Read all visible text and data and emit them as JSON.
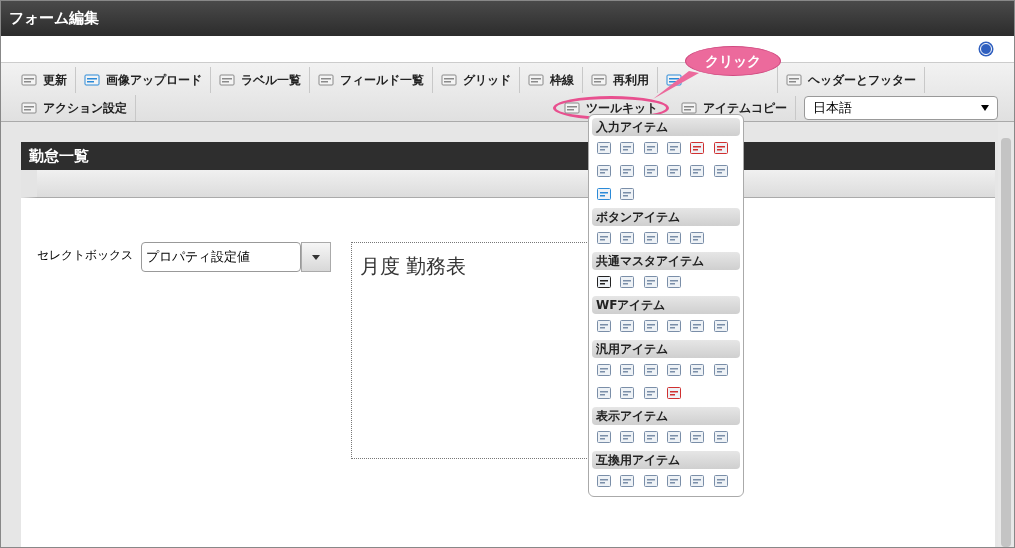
{
  "window": {
    "title": "フォーム編集"
  },
  "toolbar": {
    "row_1": [
      {
        "label": "更新"
      },
      {
        "label": "画像アップロード"
      },
      {
        "label": "ラベル一覧"
      },
      {
        "label": "フィールド一覧"
      },
      {
        "label": "グリッド"
      },
      {
        "label": "枠線"
      },
      {
        "label": "再利用"
      },
      {
        "covered": true
      },
      {
        "label": "ヘッダーとフッター"
      }
    ],
    "row_2_left": [
      {
        "label": "アクション設定"
      }
    ],
    "row_2_right": [
      {
        "label": "ツールキット",
        "highlighted": true
      },
      {
        "label": "アイテムコピー",
        "highlighted": false
      }
    ],
    "language": {
      "value": "日本語"
    }
  },
  "callout": {
    "text": "クリック"
  },
  "form": {
    "title": "勤怠一覧",
    "select_label": "セレクトボックス",
    "select_value": "プロパティ設定値",
    "heading": "月度 勤務表"
  },
  "toolkit_menu": {
    "sections": [
      {
        "title": "入力アイテム"
      },
      {
        "title": "ボタンアイテム"
      },
      {
        "title": "共通マスタアイテム"
      },
      {
        "title": "WFアイテム"
      },
      {
        "title": "汎用アイテム"
      },
      {
        "title": "表示アイテム"
      },
      {
        "title": "互換用アイテム"
      }
    ]
  }
}
